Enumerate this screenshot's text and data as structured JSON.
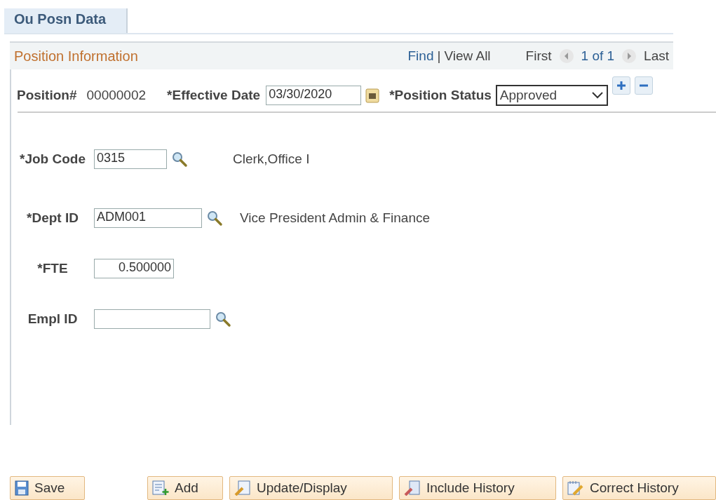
{
  "tabs": [
    {
      "label": "Ou Posn Data",
      "selected": true
    }
  ],
  "section": {
    "title": "Position Information",
    "find": "Find",
    "separator": "|",
    "view_all": "View All",
    "first": "First",
    "counter": "1 of 1",
    "last": "Last"
  },
  "position": {
    "label": "Position#",
    "value": "00000002",
    "date_label": "*Effective Date",
    "date_value": "03/30/2020",
    "status_label": "*Position Status",
    "status_value": "Approved"
  },
  "fields": [
    {
      "kind": "lookup",
      "label": "*Job Code",
      "value": "0315",
      "description": "Clerk,Office I"
    },
    {
      "kind": "lookup",
      "label": "*Dept ID",
      "value": "ADM001",
      "description": "Vice President Admin & Finance"
    },
    {
      "kind": "number",
      "label": "*FTE",
      "value": "0.500000"
    },
    {
      "kind": "lookup",
      "label": "Empl ID"
    }
  ],
  "buttons": [
    {
      "label": "Save",
      "kind": "save"
    },
    {
      "label": "Add",
      "kind": "add"
    },
    {
      "label": "Update/Display",
      "kind": "update"
    },
    {
      "label": "Include History",
      "kind": "history"
    },
    {
      "label": "Correct History",
      "kind": "correct"
    }
  ]
}
